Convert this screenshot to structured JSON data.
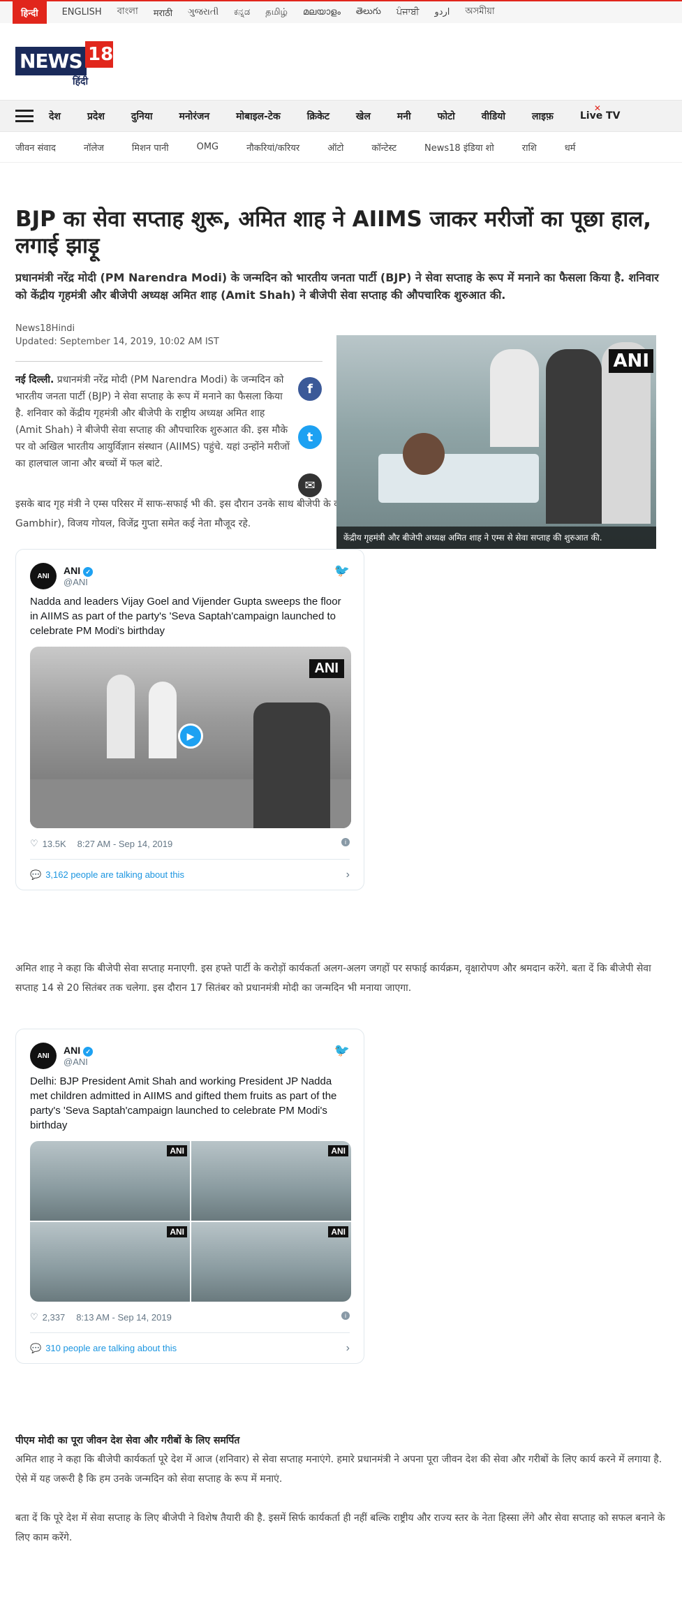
{
  "languages": [
    "हिन्दी",
    "ENGLISH",
    "বাংলা",
    "मराठी",
    "ગુજરાતી",
    "ಕನ್ನಡ",
    "தமிழ்",
    "മലയാളം",
    "తెలుగు",
    "ਪੰਜਾਬੀ",
    "اردو",
    "অসমীয়া"
  ],
  "logo": {
    "word": "NEWS",
    "number": "18",
    "sub": "हिंदी"
  },
  "main_nav": [
    "देश",
    "प्रदेश",
    "दुनिया",
    "मनोरंजन",
    "मोबाइल-टेक",
    "क्रिकेट",
    "खेल",
    "मनी",
    "फोटो",
    "वीडियो",
    "लाइफ़",
    "Live TV"
  ],
  "sub_nav": [
    "जीवन संवाद",
    "नॉलेज",
    "मिशन पानी",
    "OMG",
    "नौकरियां/करियर",
    "ऑटो",
    "कॉन्टेस्ट",
    "News18 इंडिया शो",
    "राशि",
    "धर्म"
  ],
  "article": {
    "headline": "BJP का सेवा सप्ताह शुरू, अमित शाह ने AIIMS जाकर मरीजों का पूछा हाल, लगाई झाड़ू",
    "summary": "प्रधानमंत्री नरेंद्र मोदी (PM Narendra Modi) के जन्मदिन को भारतीय जनता पार्टी (BJP) ने सेवा सप्ताह के रूप में मनाने का फैसला किया है. शनिवार को केंद्रीय गृहमंत्री और बीजेपी अध्यक्ष अमित शाह (Amit Shah) ने बीजेपी सेवा सप्ताह की औपचारिक शुरुआत की.",
    "author": "News18Hindi",
    "updated": "Updated: September 14, 2019, 10:02 AM IST",
    "lead_place": "नई दिल्ली.",
    "lead_text": " प्रधानमंत्री नरेंद्र मोदी (PM Narendra Modi) के जन्मदिन को भारतीय जनता पार्टी (BJP) ने सेवा सप्ताह के रूप में मनाने का फैसला किया है. शनिवार को केंद्रीय गृहमंत्री और बीजेपी के राष्ट्रीय अध्यक्ष अमित शाह (Amit Shah) ने बीजेपी सेवा सप्ताह की औपचारिक शुरुआत की. इस मौके पर वो अखिल भारतीय आयुर्विज्ञान संस्थान (AIIMS) पहुंचे. यहां उन्होंने मरीजों का हालचाल जाना और बच्चों में फल बांटे.",
    "image_watermark": "ANI",
    "image_caption": "केंद्रीय गृहमंत्री और बीजेपी अध्यक्ष अमित शाह ने एम्स से सेवा सप्ताह की शुरुआत की.",
    "para2": "इसके बाद गृह मंत्री ने एम्स परिसर में साफ-सफाई भी की. इस दौरान उनके साथ बीजेपी के कार्यकारी अध्यक्ष जेपी नड्डा (JP Nadda), पूर्वी दिल्ली के सांसद गौतम गंभीर (Gautam Gambhir), विजय गोयल, विजेंद्र गुप्ता समेत कई नेता मौजूद रहे.",
    "para3": "अमित शाह ने कहा कि बीजेपी सेवा सप्ताह मनाएगी. इस हफ्ते पार्टी के करोड़ों कार्यकर्ता अलग-अलग जगहों पर सफाई कार्यक्रम, वृक्षारोपण और श्रमदान करेंगे. बता दें कि बीजेपी सेवा सप्ताह 14 से 20 सितंबर तक चलेगा. इस दौरान 17 सितंबर को प्रधानमंत्री मोदी का जन्मदिन भी मनाया जाएगा.",
    "section_heading": "पीएम मोदी का पूरा जीवन देश सेवा और गरीबों के लिए समर्पित",
    "para4": "अमित शाह ने कहा कि बीजेपी कार्यकर्ता पूरे देश में आज (शनिवार) से सेवा सप्ताह मनाएंगे. हमारे प्रधानमंत्री ने अपना पूरा जीवन देश की सेवा और गरीबों के लिए कार्य करने में लगाया है. ऐसे में यह जरूरी है कि हम उनके जन्मदिन को सेवा सप्ताह के रूप में मनाएं.",
    "para5": "बता दें कि पूरे देश में सेवा सप्ताह के लिए बीजेपी ने विशेष तैयारी की है. इसमें सिर्फ कार्यकर्ता ही नहीं बल्कि राष्ट्रीय और राज्य स्तर के नेता हिस्सा लेंगे और सेवा सप्ताह को सफल बनाने के लिए काम करेंगे."
  },
  "tweet1": {
    "name": "ANI",
    "handle": "@ANI",
    "text": "Nadda and leaders Vijay Goel and Vijender Gupta sweeps the floor in AIIMS as part of the party's 'Seva Saptah'campaign launched to celebrate PM Modi's birthday",
    "watermark": "ANI",
    "likes": "13.5K",
    "time": "8:27 AM - Sep 14, 2019",
    "talking": "3,162 people are talking about this"
  },
  "tweet2": {
    "name": "ANI",
    "handle": "@ANI",
    "text": "Delhi: BJP President Amit Shah and working President JP Nadda met children admitted in AIIMS and gifted them fruits as part of the party's 'Seva Saptah'campaign launched to celebrate PM Modi's birthday",
    "watermark": "ANI",
    "likes": "2,337",
    "time": "8:13 AM - Sep 14, 2019",
    "talking": "310 people are talking about this"
  }
}
